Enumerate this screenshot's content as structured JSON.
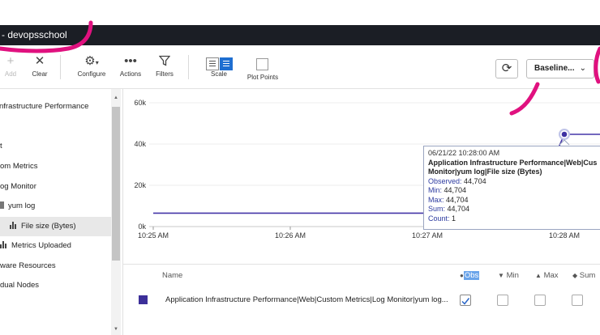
{
  "window": {
    "title": "- devopsschool"
  },
  "toolbar": {
    "add_label": "Add",
    "clear_label": "Clear",
    "configure_label": "Configure",
    "actions_label": "Actions",
    "filters_label": "Filters",
    "scale_label": "Scale",
    "plot_points_label": "Plot Points",
    "baseline_label": "Baseline..."
  },
  "sidebar": {
    "items": [
      {
        "label": "nfrastructure Performance"
      },
      {
        "label": "t"
      },
      {
        "label": "om Metrics"
      },
      {
        "label": "og Monitor"
      },
      {
        "label": "yum log"
      },
      {
        "label": "File size (Bytes)"
      },
      {
        "label": "Metrics Uploaded"
      },
      {
        "label": "ware Resources"
      },
      {
        "label": "dual Nodes"
      }
    ]
  },
  "tooltip": {
    "time": "06/21/22 10:28:00 AM",
    "metric_line1": "Application Infrastructure Performance|Web|Cus",
    "metric_line2": "Monitor|yum log|File size (Bytes)",
    "observed_label": "Observed:",
    "observed_value": "44,704",
    "min_label": "Min:",
    "min_value": "44,704",
    "max_label": "Max:",
    "max_value": "44,704",
    "sum_label": "Sum:",
    "sum_value": "44,704",
    "count_label": "Count:",
    "count_value": "1"
  },
  "legend": {
    "name_header": "Name",
    "obs_header": "Obs",
    "min_header": "Min",
    "max_header": "Max",
    "sum_header": "Sum",
    "row_name": "Application Infrastructure Performance|Web|Custom Metrics|Log Monitor|yum log...",
    "series_color": "#3c2f99"
  },
  "chart_data": {
    "type": "line",
    "y_ticks": [
      "60k",
      "40k",
      "20k",
      "0k"
    ],
    "x_ticks": [
      "10:25 AM",
      "10:26 AM",
      "10:27 AM",
      "10:28 AM"
    ],
    "ylim": [
      0,
      60000
    ],
    "series": [
      {
        "points": [
          {
            "x": "10:25 AM",
            "y": 6500
          },
          {
            "x": "10:26 AM",
            "y": 6500
          },
          {
            "x": "10:27 AM",
            "y": 6500
          },
          {
            "x": "10:27:45 AM",
            "y": 6500
          },
          {
            "x": "10:28 AM",
            "y": 44704
          },
          {
            "x": "10:28:45 AM",
            "y": 44704
          }
        ],
        "color": "#4536a8"
      }
    ],
    "highlight": {
      "x": "10:28 AM",
      "y": 44704
    },
    "grid": true
  }
}
